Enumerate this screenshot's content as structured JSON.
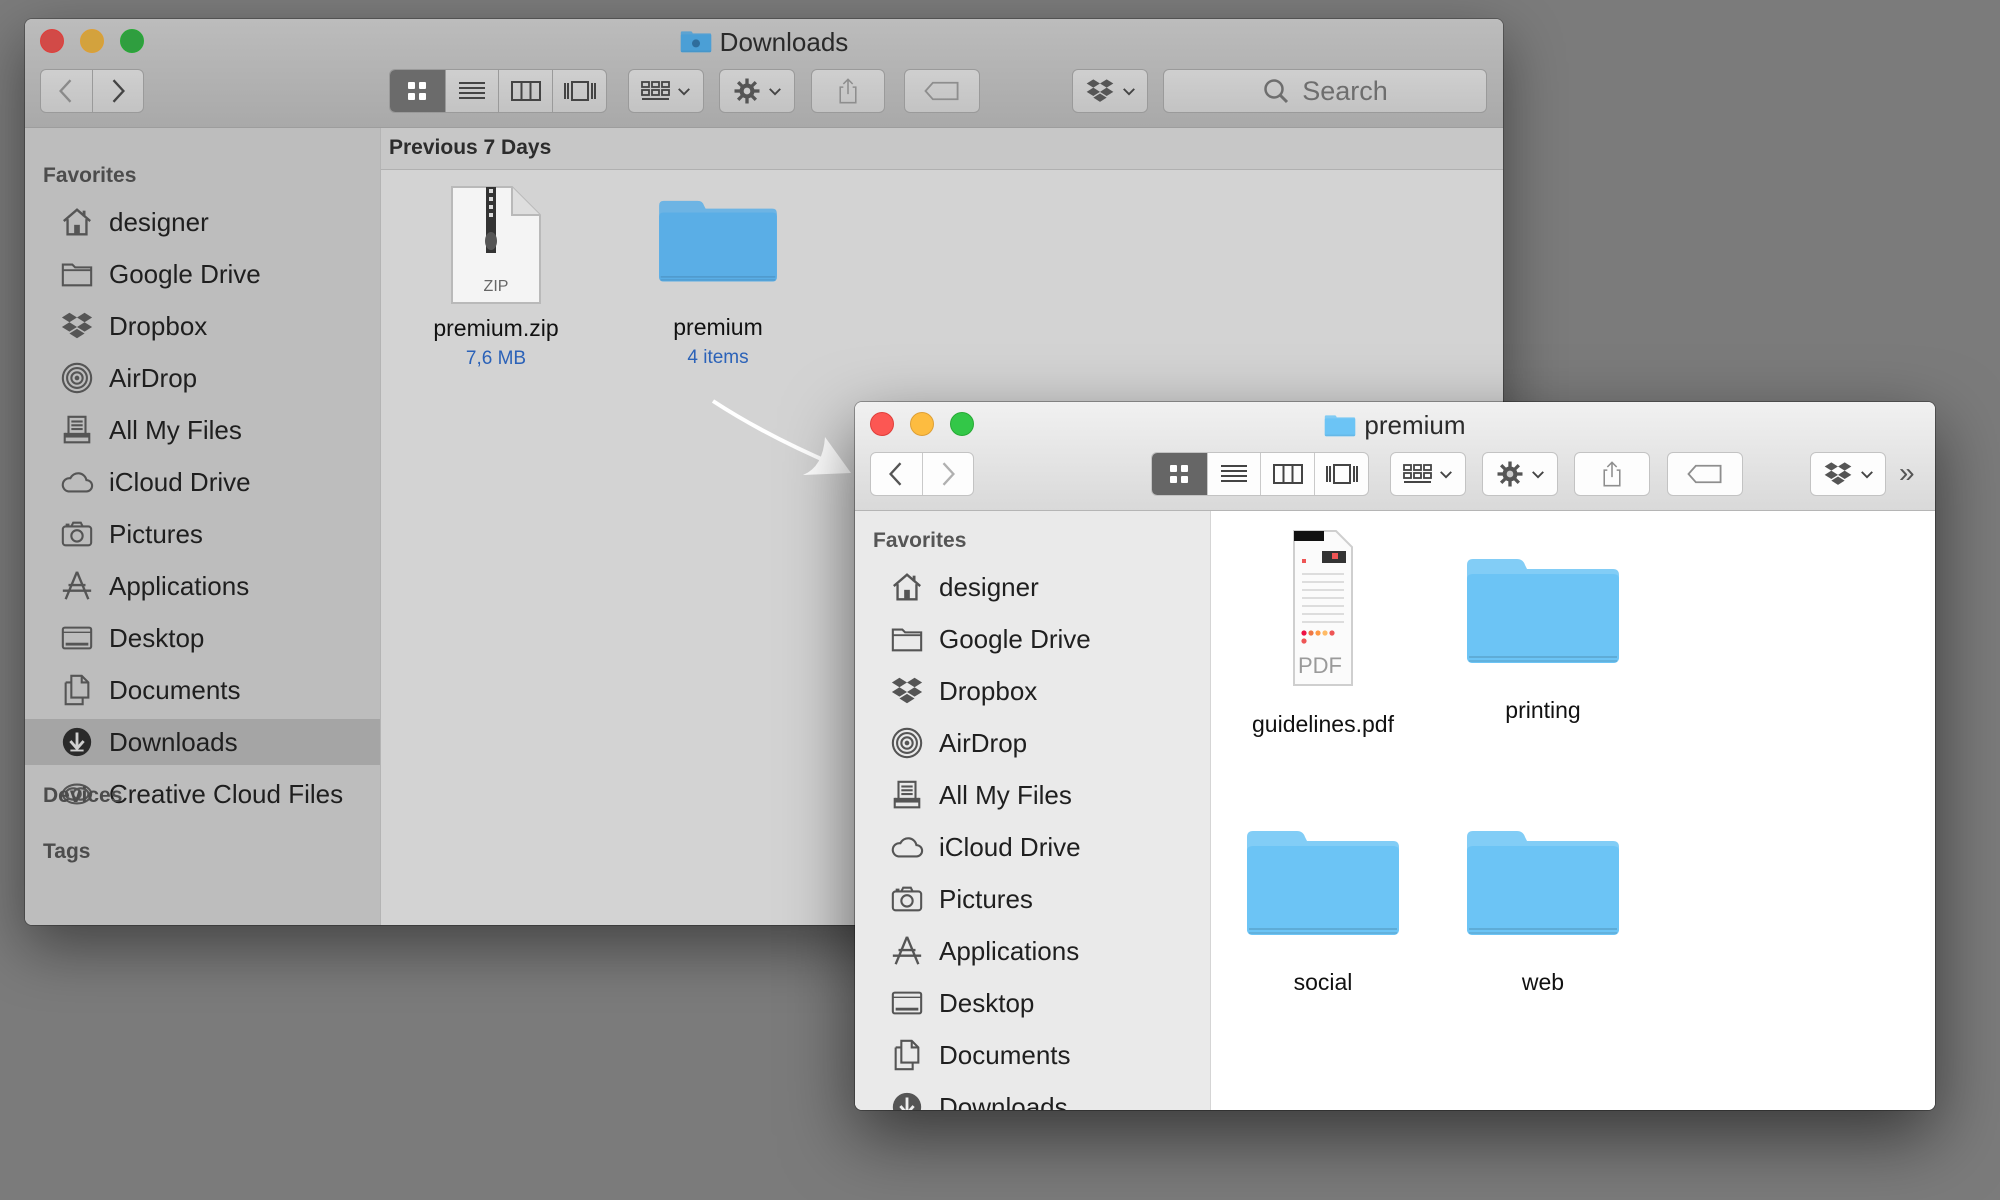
{
  "colors": {
    "folder": "#5aaee6",
    "folder_bright": "#6cc4f5",
    "selection": "#a5a5a5"
  },
  "downloads_window": {
    "title": "Downloads",
    "search_placeholder": "Search",
    "sidebar": {
      "favorites_header": "Favorites",
      "items": [
        {
          "label": "designer",
          "icon": "home-icon"
        },
        {
          "label": "Google Drive",
          "icon": "folder-icon"
        },
        {
          "label": "Dropbox",
          "icon": "dropbox-icon"
        },
        {
          "label": "AirDrop",
          "icon": "airdrop-icon"
        },
        {
          "label": "All My Files",
          "icon": "all-files-icon"
        },
        {
          "label": "iCloud Drive",
          "icon": "cloud-icon"
        },
        {
          "label": "Pictures",
          "icon": "camera-icon"
        },
        {
          "label": "Applications",
          "icon": "applications-icon"
        },
        {
          "label": "Desktop",
          "icon": "desktop-icon"
        },
        {
          "label": "Documents",
          "icon": "documents-icon"
        },
        {
          "label": "Downloads",
          "icon": "downloads-icon",
          "selected": true
        },
        {
          "label": "Creative Cloud Files",
          "icon": "creative-cloud-icon"
        }
      ],
      "devices_header": "Devices",
      "tags_header": "Tags"
    },
    "group_header": "Previous 7 Days",
    "files": [
      {
        "name": "premium.zip",
        "sub": "7,6 MB",
        "type": "zip",
        "badge": "ZIP"
      },
      {
        "name": "premium",
        "sub": "4 items",
        "type": "folder"
      }
    ]
  },
  "premium_window": {
    "title": "premium",
    "overflow": "»",
    "sidebar": {
      "favorites_header": "Favorites",
      "items": [
        {
          "label": "designer",
          "icon": "home-icon"
        },
        {
          "label": "Google Drive",
          "icon": "folder-icon"
        },
        {
          "label": "Dropbox",
          "icon": "dropbox-icon"
        },
        {
          "label": "AirDrop",
          "icon": "airdrop-icon"
        },
        {
          "label": "All My Files",
          "icon": "all-files-icon"
        },
        {
          "label": "iCloud Drive",
          "icon": "cloud-icon"
        },
        {
          "label": "Pictures",
          "icon": "camera-icon"
        },
        {
          "label": "Applications",
          "icon": "applications-icon"
        },
        {
          "label": "Desktop",
          "icon": "desktop-icon"
        },
        {
          "label": "Documents",
          "icon": "documents-icon"
        },
        {
          "label": "Downloads",
          "icon": "downloads-icon"
        }
      ]
    },
    "files": [
      {
        "name": "guidelines.pdf",
        "type": "pdf",
        "badge": "PDF"
      },
      {
        "name": "printing",
        "type": "folder"
      },
      {
        "name": "social",
        "type": "folder"
      },
      {
        "name": "web",
        "type": "folder"
      }
    ]
  }
}
